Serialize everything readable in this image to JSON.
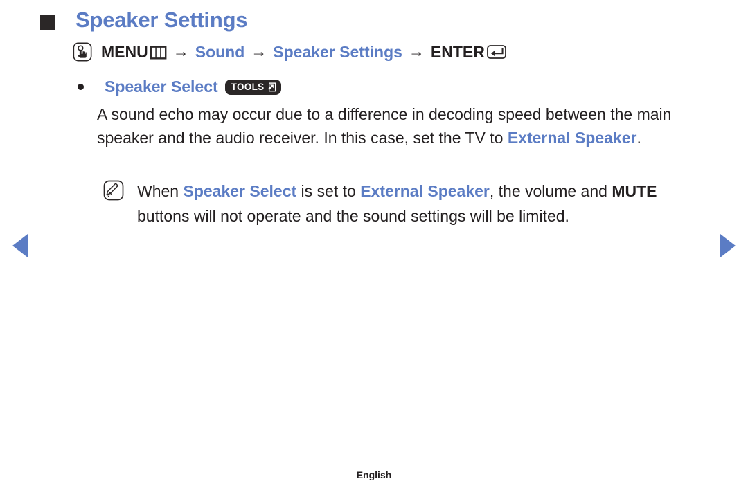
{
  "page": {
    "title": "Speaker Settings",
    "language_footer": "English"
  },
  "menu_path": {
    "press_icon": "hand-press-icon",
    "menu_label": "MENU",
    "menu_glyph": "menu-grid-icon",
    "arrow": "→",
    "steps": [
      {
        "label": "Sound",
        "color": "#5b7cc4"
      },
      {
        "label": "Speaker Settings",
        "color": "#5b7cc4"
      }
    ],
    "enter_label": "ENTER",
    "enter_glyph": "enter-key-icon"
  },
  "bullet_item": {
    "dot": "bullet-dot",
    "label": "Speaker Select",
    "badge": {
      "text": "TOOLS",
      "glyph": "tools-arrow-icon"
    }
  },
  "body": {
    "part1": "A sound echo may occur due to a difference in decoding speed between the main speaker and the audio receiver. In this case, set the TV to ",
    "highlight1": "External Speaker",
    "part2": "."
  },
  "note": {
    "icon": "note-pencil-icon",
    "prefix": "When ",
    "term1": "Speaker Select",
    "mid1": " is set to ",
    "term2": "External Speaker",
    "mid2": ", the volume and ",
    "bold1": "MUTE",
    "suffix": " buttons will not operate and the sound settings will be limited."
  },
  "navigation": {
    "prev_label": "previous-page",
    "next_label": "next-page"
  },
  "colors": {
    "accent_blue": "#5b7cc4",
    "text_dark": "#231f20",
    "badge_bg": "#2b2727",
    "background": "#ffffff"
  }
}
